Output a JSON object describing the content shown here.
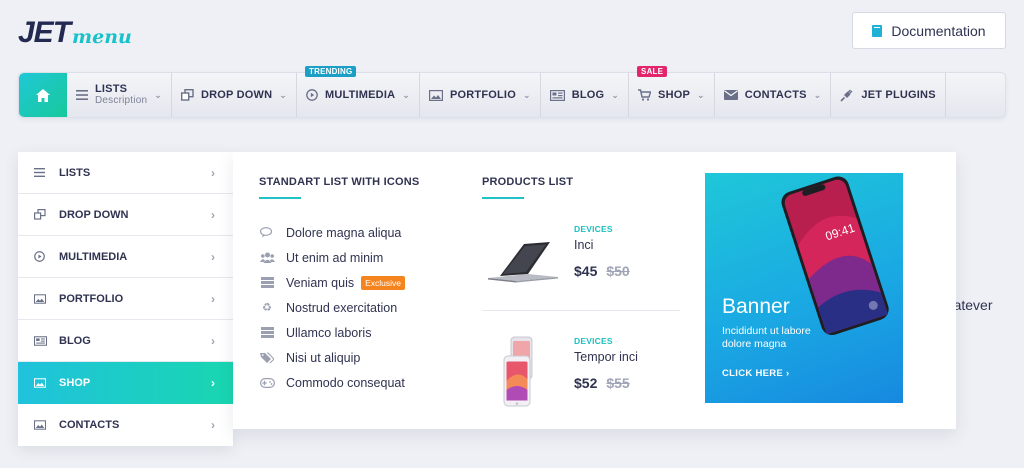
{
  "logo": {
    "part1": "JET",
    "part2": "menu"
  },
  "doc_button": {
    "label": "Documentation"
  },
  "topnav": {
    "items": [
      {
        "label": "LISTS",
        "sub": "Description"
      },
      {
        "label": "DROP DOWN"
      },
      {
        "label": "MULTIMEDIA",
        "badge": "TRENDING"
      },
      {
        "label": "PORTFOLIO"
      },
      {
        "label": "BLOG"
      },
      {
        "label": "SHOP",
        "badge": "SALE"
      },
      {
        "label": "CONTACTS"
      },
      {
        "label": "JET PLUGINS"
      }
    ]
  },
  "sidemenu": {
    "items": [
      {
        "label": "LISTS"
      },
      {
        "label": "DROP DOWN"
      },
      {
        "label": "MULTIMEDIA"
      },
      {
        "label": "PORTFOLIO"
      },
      {
        "label": "BLOG"
      },
      {
        "label": "SHOP",
        "active": true
      },
      {
        "label": "CONTACTS"
      }
    ]
  },
  "panel": {
    "list_title": "STANDART LIST WITH ICONS",
    "list_items": [
      {
        "label": "Dolore magna aliqua"
      },
      {
        "label": "Ut enim ad minim"
      },
      {
        "label": "Veniam quis",
        "tag": "Exclusive"
      },
      {
        "label": "Nostrud exercitation"
      },
      {
        "label": "Ullamco laboris"
      },
      {
        "label": "Nisi ut aliquip"
      },
      {
        "label": "Commodo consequat"
      }
    ],
    "products_title": "PRODUCTS LIST",
    "products": [
      {
        "category": "DEVICES",
        "name": "Inci",
        "price": "$45",
        "old_price": "$50"
      },
      {
        "category": "DEVICES",
        "name": "Tempor inci",
        "price": "$52",
        "old_price": "$55"
      }
    ],
    "banner": {
      "title": "Banner",
      "subtitle": "Incididunt ut labore dolore magna",
      "cta": "CLICK HERE",
      "phone_time": "09:41"
    }
  },
  "background_text": "n whatever",
  "colors": {
    "accent_teal": "#20c2c7",
    "trending_badge": "#1b9fc6",
    "sale_badge": "#e3266b",
    "exclusive_tag": "#f5841f"
  }
}
